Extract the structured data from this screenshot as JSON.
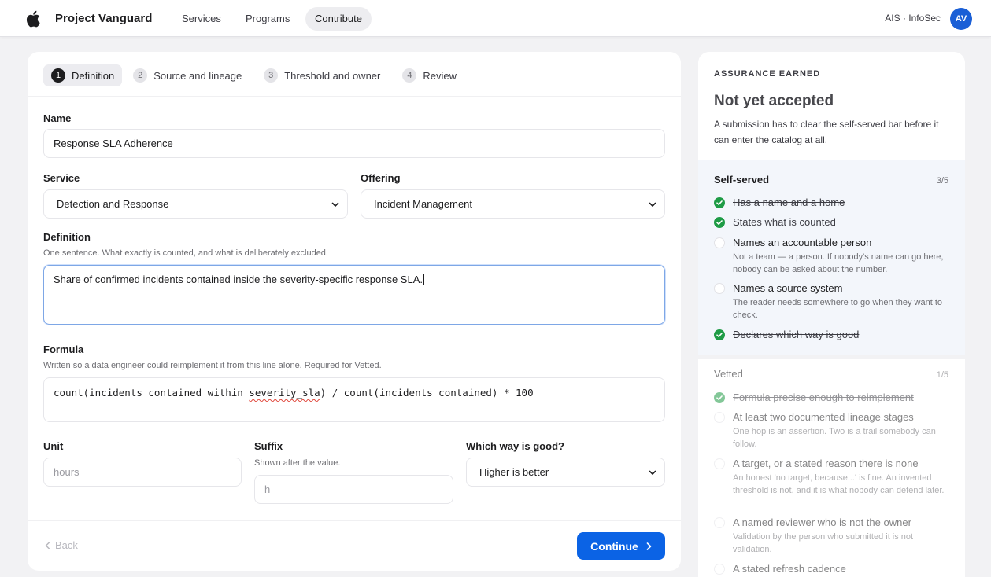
{
  "nav": {
    "brand": "Project Vanguard",
    "links": [
      "Services",
      "Programs",
      "Contribute"
    ],
    "org": "AIS · InfoSec",
    "avatar": "AV"
  },
  "steps": [
    {
      "num": "1",
      "label": "Definition"
    },
    {
      "num": "2",
      "label": "Source and lineage"
    },
    {
      "num": "3",
      "label": "Threshold and owner"
    },
    {
      "num": "4",
      "label": "Review"
    }
  ],
  "form": {
    "name_label": "Name",
    "name_value": "Response SLA Adherence",
    "service_label": "Service",
    "service_value": "Detection and Response",
    "offering_label": "Offering",
    "offering_value": "Incident Management",
    "definition_label": "Definition",
    "definition_hint": "One sentence. What exactly is counted, and what is deliberately excluded.",
    "definition_value": "Share of confirmed incidents contained inside the severity-specific response SLA.",
    "formula_label": "Formula",
    "formula_hint": "Written so a data engineer could reimplement it from this line alone. Required for Vetted.",
    "formula_pre": "count(incidents contained within ",
    "formula_flag": "severity_sla",
    "formula_post": ") / count(incidents contained) * 100",
    "unit_label": "Unit",
    "unit_placeholder": "hours",
    "suffix_label": "Suffix",
    "suffix_hint": "Shown after the value.",
    "suffix_placeholder": "h",
    "direction_label": "Which way is good?",
    "direction_value": "Higher is better"
  },
  "footer": {
    "back_label": "Back",
    "continue_label": "Continue"
  },
  "assurance": {
    "kicker": "ASSURANCE EARNED",
    "title": "Not yet accepted",
    "description": "A submission has to clear the self-served bar before it can enter the catalog at all.",
    "self_served": {
      "name": "Self-served",
      "count": "3/5",
      "criteria": [
        {
          "title": "Has a name and a home",
          "done": true,
          "desc": ""
        },
        {
          "title": "States what is counted",
          "done": true,
          "desc": ""
        },
        {
          "title": "Names an accountable person",
          "done": false,
          "desc": "Not a team — a person. If nobody's name can go here, nobody can be asked about the number."
        },
        {
          "title": "Names a source system",
          "done": false,
          "desc": "The reader needs somewhere to go when they want to check."
        },
        {
          "title": "Declares which way is good",
          "done": true,
          "desc": ""
        }
      ]
    },
    "vetted": {
      "name": "Vetted",
      "count": "1/5",
      "criteria": [
        {
          "title": "Formula precise enough to reimplement",
          "done": true,
          "desc": ""
        },
        {
          "title": "At least two documented lineage stages",
          "done": false,
          "desc": "One hop is an assertion. Two is a trail somebody can follow."
        },
        {
          "title": "A target, or a stated reason there is none",
          "done": false,
          "desc": "An honest 'no target, because...' is fine. An invented threshold is not, and it is what nobody can defend later."
        },
        {
          "title": "A named reviewer who is not the owner",
          "done": false,
          "desc": "Validation by the person who submitted it is not validation."
        },
        {
          "title": "A stated refresh cadence",
          "done": false,
          "desc": ""
        }
      ]
    }
  },
  "colors": {
    "accent": "#0b63e5",
    "done": "#1e9b45",
    "avatar": "#1a5fd6"
  }
}
